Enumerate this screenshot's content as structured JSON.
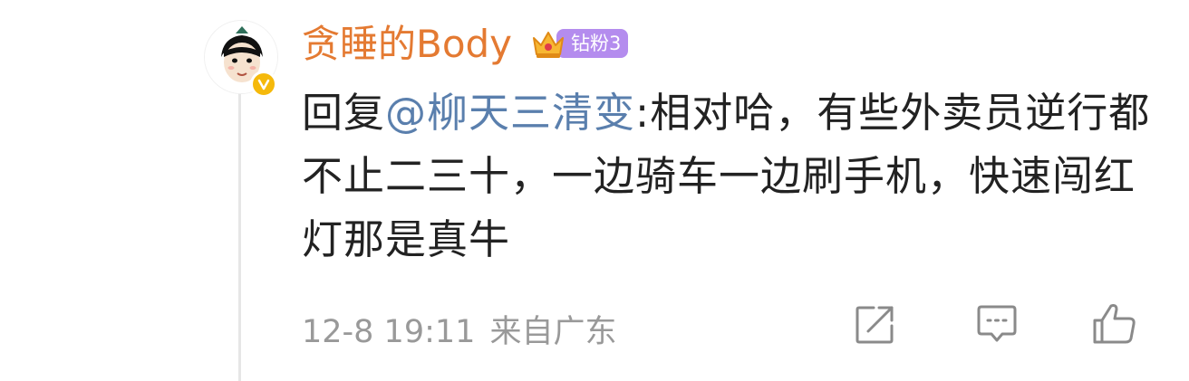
{
  "comment": {
    "username": "贪睡的Body",
    "fan_badge": "钻粉3",
    "reply_prefix": "回复",
    "mention": "@柳天三清变",
    "text": ":相对哈，有些外卖员逆行都不止二三十，一边骑车一边刷手机，快速闯红灯那是真牛",
    "time": "12-8 19:11",
    "location": "来自广东"
  },
  "icons": {
    "avatar": "cartoon-avatar-icon",
    "verified": "verified-v-icon",
    "crown": "crown-icon",
    "share": "share-icon",
    "comment": "comment-icon",
    "like": "like-icon"
  },
  "colors": {
    "username": "#e47a32",
    "mention": "#5a7fad",
    "fan_badge": "#b48cee",
    "verified": "#f5b90b",
    "meta": "#999999",
    "text": "#222222"
  }
}
